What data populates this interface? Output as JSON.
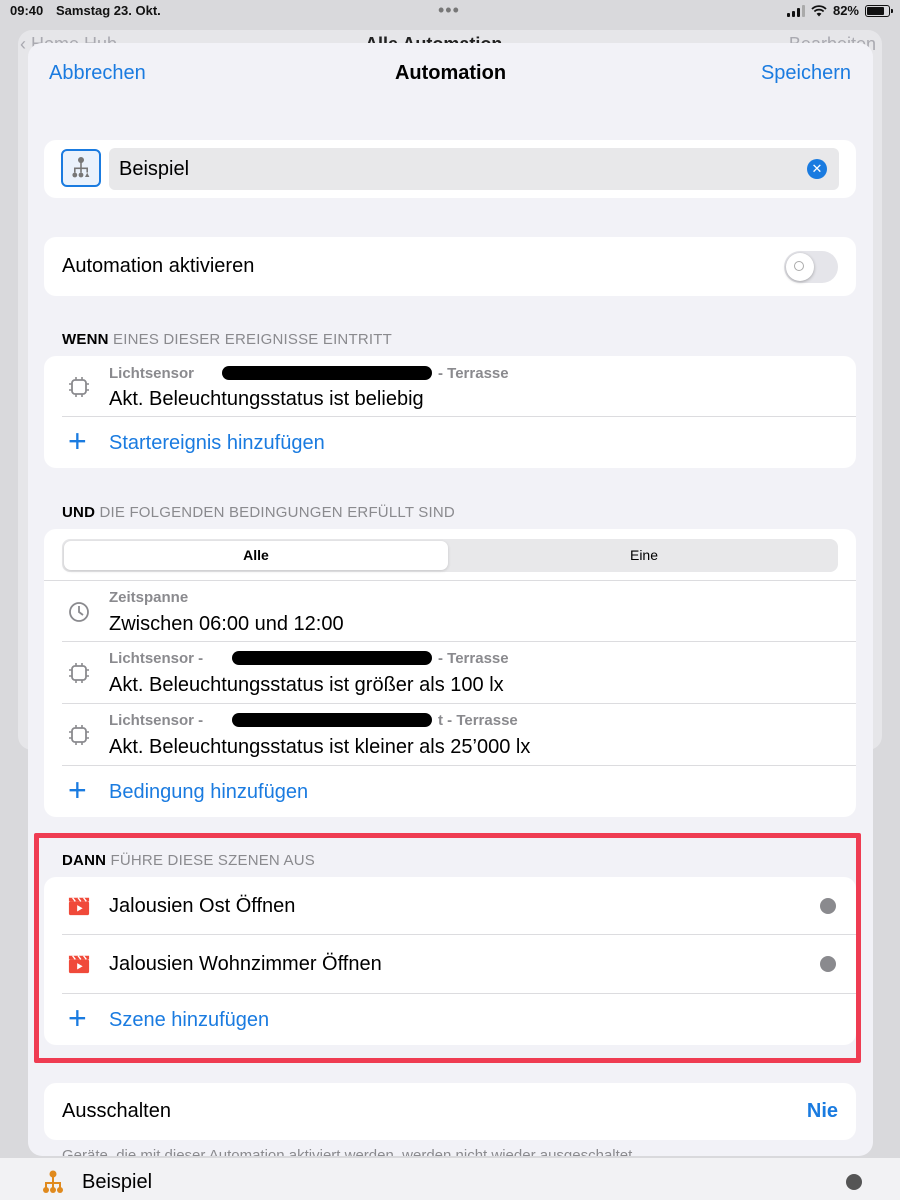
{
  "status_bar": {
    "time": "09:40",
    "date": "Samstag 23. Okt.",
    "battery": "82%",
    "battery_level": 0.82
  },
  "background": {
    "header_left": "Home Hub",
    "header_center": "Alle Automation",
    "header_right": "Bearbeiten",
    "bottom_item": "Beispiel"
  },
  "nav": {
    "cancel": "Abbrechen",
    "title": "Automation",
    "save": "Speichern"
  },
  "name_field": {
    "value": "Beispiel"
  },
  "toggle": {
    "label": "Automation aktivieren",
    "enabled": false
  },
  "triggers": {
    "header_bold": "WENN",
    "header_rest": " EINES DIESER EREIGNISSE EINTRITT",
    "items": [
      {
        "sub_prefix": "Lichtsensor",
        "sub_suffix": "- Terrasse",
        "main": "Akt. Beleuchtungsstatus ist beliebig"
      }
    ],
    "add_label": "Startereignis hinzufügen"
  },
  "conditions": {
    "header_bold": "UND",
    "header_rest": " DIE FOLGENDEN BEDINGUNGEN ERFÜLLT SIND",
    "segment_all": "Alle",
    "segment_one": "Eine",
    "items": [
      {
        "sub": "Zeitspanne",
        "main": "Zwischen 06:00 und 12:00"
      },
      {
        "sub_prefix": "Lichtsensor -",
        "sub_suffix": "- Terrasse",
        "main": "Akt. Beleuchtungsstatus ist größer als 100 lx"
      },
      {
        "sub_prefix": "Lichtsensor -",
        "sub_suffix": "t - Terrasse",
        "main": "Akt. Beleuchtungsstatus ist kleiner als 25’000 lx"
      }
    ],
    "add_label": "Bedingung hinzufügen"
  },
  "scenes": {
    "header_bold": "DANN",
    "header_rest": " FÜHRE DIESE SZENEN AUS",
    "items": [
      {
        "label": "Jalousien Ost Öffnen"
      },
      {
        "label": "Jalousien Wohnzimmer Öffnen"
      }
    ],
    "add_label": "Szene hinzufügen"
  },
  "turn_off": {
    "label": "Ausschalten",
    "value": "Nie",
    "footnote": "Geräte, die mit dieser Automation aktiviert werden, werden nicht wieder ausgeschaltet."
  },
  "colors": {
    "accent": "#1a7be0",
    "highlight": "#ef3c52",
    "scene_icon": "#f04a3a"
  }
}
